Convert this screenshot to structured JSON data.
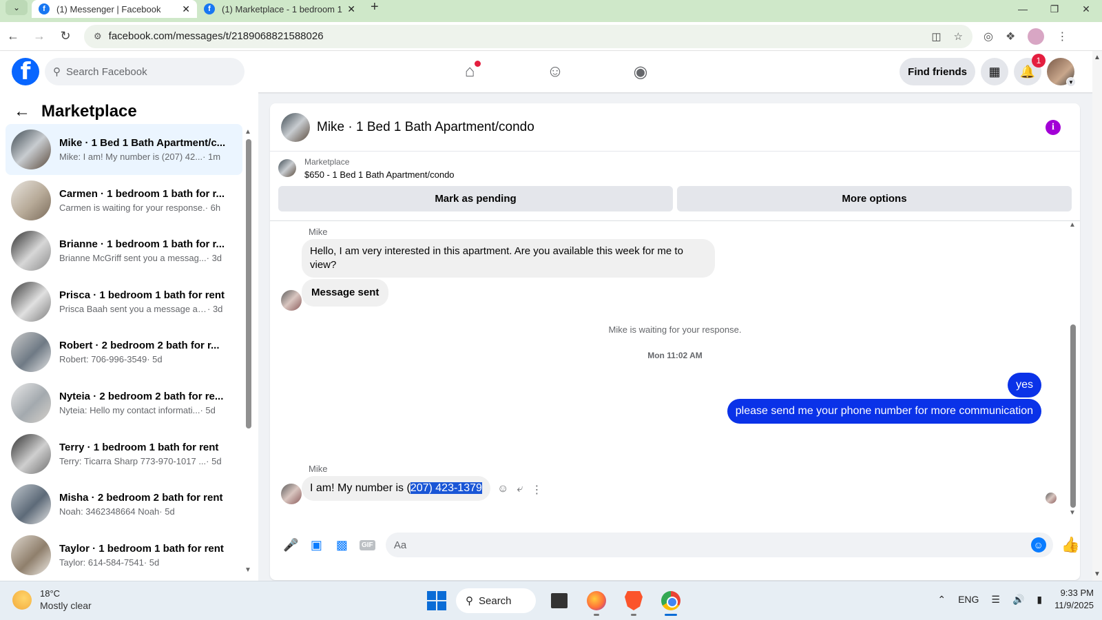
{
  "browser": {
    "tabs": [
      {
        "title": "(1) Messenger | Facebook",
        "active": true
      },
      {
        "title": "(1) Marketplace - 1 bedroom 1",
        "active": false
      }
    ],
    "url": "facebook.com/messages/t/2189068821588026"
  },
  "fb_header": {
    "search_placeholder": "Search Facebook",
    "find_friends_label": "Find friends",
    "notification_count": "1"
  },
  "sidebar": {
    "title": "Marketplace",
    "conversations": [
      {
        "name": "Mike · 1 Bed 1 Bath Apartment/c...",
        "preview": "Mike: I am! My number is (207) 42...",
        "time": "· 1m",
        "active": true
      },
      {
        "name": "Carmen · 1 bedroom 1 bath for r...",
        "preview": "Carmen is waiting for your response.",
        "time": "· 6h",
        "active": false
      },
      {
        "name": "Brianne · 1 bedroom 1 bath for r...",
        "preview": "Brianne McGriff sent you a messag...",
        "time": "· 3d",
        "active": false
      },
      {
        "name": "Prisca · 1 bedroom 1 bath for rent",
        "preview": "Prisca Baah sent you a message ab...",
        "time": "· 3d",
        "active": false
      },
      {
        "name": "Robert · 2 bedroom 2 bath for r...",
        "preview": "Robert: 706-996-3549",
        "time": "· 5d",
        "active": false
      },
      {
        "name": "Nyteia · 2 bedroom 2 bath for re...",
        "preview": "Nyteia: Hello my contact informati...",
        "time": "· 5d",
        "active": false
      },
      {
        "name": "Terry · 1 bedroom 1 bath for rent",
        "preview": "Terry: Ticarra Sharp 773-970-1017 ...",
        "time": "· 5d",
        "active": false
      },
      {
        "name": "Misha · 2 bedroom 2 bath for rent",
        "preview": "Noah: 3462348664 Noah",
        "time": "· 5d",
        "active": false
      },
      {
        "name": "Taylor · 1 bedroom 1 bath for rent",
        "preview": "Taylor: 614-584-7541",
        "time": "· 5d",
        "active": false
      }
    ]
  },
  "chat": {
    "title": "Mike · 1 Bed 1 Bath Apartment/condo",
    "listing_category": "Marketplace",
    "listing_price": "$650 - 1 Bed 1 Bath Apartment/condo",
    "mark_pending_label": "Mark as pending",
    "more_options_label": "More options",
    "sender_name": "Mike",
    "msg1": "Hello, I am very interested in this apartment. Are you available this week for me to view?",
    "msg2": "Message sent",
    "waiting_text": "Mike is waiting for your response.",
    "timestamp": "Mon 11:02 AM",
    "out1": "yes",
    "out2": "please send me your phone number for more communication",
    "msg3_prefix": "I am! My number is (",
    "msg3_selected": "207) 423-1379",
    "composer_placeholder": "Aa"
  },
  "taskbar": {
    "temperature": "18°C",
    "weather": "Mostly clear",
    "search_label": "Search",
    "language": "ENG",
    "time": "9:33 PM",
    "date": "11/9/2025"
  },
  "colors": {
    "fb_blue": "#0866ff",
    "outgoing_bubble": "#0a32e8",
    "incoming_bubble": "#f0f0f0",
    "notification_red": "#e41e3f",
    "info_purple": "#a200d6"
  }
}
